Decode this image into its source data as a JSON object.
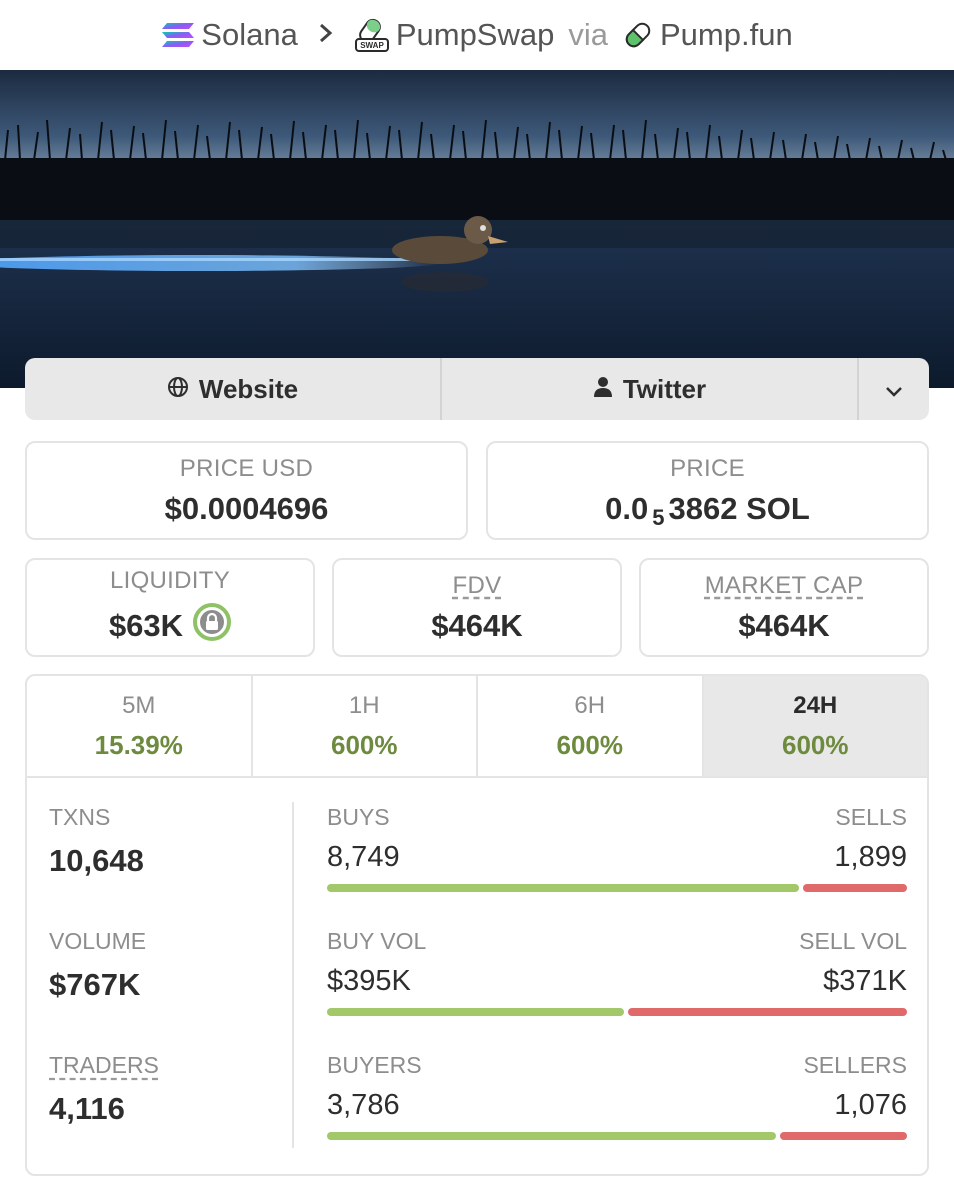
{
  "breadcrumb": {
    "chain": "Solana",
    "dex": "PumpSwap",
    "via": "via",
    "launchpad": "Pump.fun",
    "dex_icon_text": "SWAP"
  },
  "links": {
    "website": "Website",
    "twitter": "Twitter"
  },
  "stats": {
    "price_usd_label": "PRICE USD",
    "price_usd": "$0.0004696",
    "price_label": "PRICE",
    "price_prefix": "0.0",
    "price_subscript": "5",
    "price_suffix": "3862 SOL",
    "liquidity_label": "LIQUIDITY",
    "liquidity": "$63K",
    "fdv_label": "FDV",
    "fdv": "$464K",
    "mcap_label": "MARKET CAP",
    "mcap": "$464K"
  },
  "periods": [
    {
      "label": "5M",
      "change": "15.39%"
    },
    {
      "label": "1H",
      "change": "600%"
    },
    {
      "label": "6H",
      "change": "600%"
    },
    {
      "label": "24H",
      "change": "600%",
      "selected": true
    }
  ],
  "metrics": {
    "txns_label": "TXNS",
    "txns": "10,648",
    "volume_label": "VOLUME",
    "volume": "$767K",
    "traders_label": "TRADERS",
    "traders": "4,116"
  },
  "breakdown": [
    {
      "left_label": "BUYS",
      "left_value": "8,749",
      "right_label": "SELLS",
      "right_value": "1,899",
      "left_fraction": 0.82
    },
    {
      "left_label": "BUY VOL",
      "left_value": "$395K",
      "right_label": "SELL VOL",
      "right_value": "$371K",
      "left_fraction": 0.516
    },
    {
      "left_label": "BUYERS",
      "left_value": "3,786",
      "right_label": "SELLERS",
      "right_value": "1,076",
      "left_fraction": 0.779
    }
  ],
  "colors": {
    "positive": "#6e8a3f",
    "buy_bar": "#a3c86a",
    "sell_bar": "#e06a6a",
    "lock_badge": "#8fc266"
  },
  "icons": [
    "solana-icon",
    "chevron-right-icon",
    "pumpswap-icon",
    "pill-icon",
    "globe-icon",
    "user-icon",
    "chevron-down-icon",
    "lock-icon"
  ]
}
